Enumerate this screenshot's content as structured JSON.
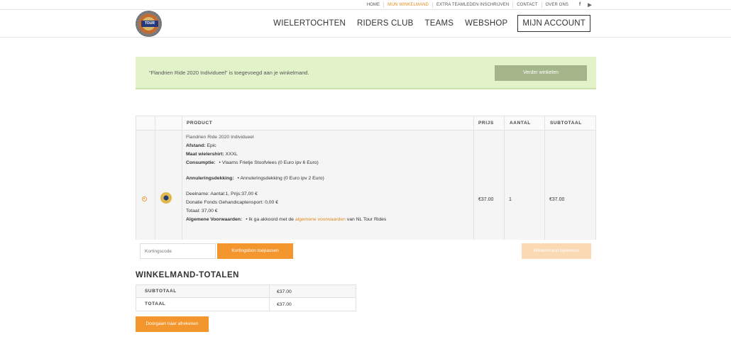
{
  "topnav": {
    "items": [
      "HOME",
      "MIJN WINKELMAND",
      "EXTRA TEAMLEDEN INSCHRIJVEN",
      "CONTACT",
      "OVER ONS"
    ],
    "social": [
      "f",
      "▶"
    ]
  },
  "header": {
    "logo_text": "TOUR",
    "nav": [
      "WIELERTOCHTEN",
      "RIDERS CLUB",
      "TEAMS",
      "WEBSHOP"
    ],
    "account": "MIJN ACCOUNT"
  },
  "notice": {
    "message": "“Flandrien Ride 2020 Individueel” is toegevoegd aan je winkelmand.",
    "button": "Verder winkelen"
  },
  "cart": {
    "headers": [
      "PRODUCT",
      "PRIJS",
      "AANTAL",
      "SUBTOTAAL"
    ],
    "item": {
      "name": "Flandrien Ride 2020 Individueel",
      "afstand_label": "Afstand:",
      "afstand": "Epic",
      "shirt_label": "Maat wielershirt:",
      "shirt": "XXXL",
      "consumptie_label": "Consumptie:",
      "consumptie": "Vlaams Frietje Stoofvlees (0 Euro ipv 6 Euro)",
      "annulering_label": "Annuleringsdekking:",
      "annulering": "Annuleringsdekking (0 Euro ipv 2 Euro)",
      "deelname": "Deelname: Aantal:1, Prijs:37,00 €",
      "donatie": "Donatie Fonds Gehandicaptensport: 0,00 €",
      "totaal": "Totaal: 37,00 €",
      "voorwaarden_label": "Algemene Voorwaarden:",
      "voorwaarden_pre": "Ik ga akkoord met de",
      "voorwaarden_link": "algemene voorwaarden",
      "voorwaarden_post": "van NL Tour Rides",
      "price": "€37.00",
      "qty": "1",
      "subtotal": "€37.00"
    }
  },
  "coupon": {
    "placeholder": "Kortingscode",
    "apply": "Kortingsbon toepassen",
    "update": "Winkelmand bijwerken"
  },
  "totals": {
    "title": "WINKELMAND-TOTALEN",
    "subtotal_label": "SUBTOTAAL",
    "subtotal": "€37.00",
    "total_label": "TOTAAL",
    "total": "€37.00",
    "checkout": "Doorgaan naar afrekenen"
  }
}
